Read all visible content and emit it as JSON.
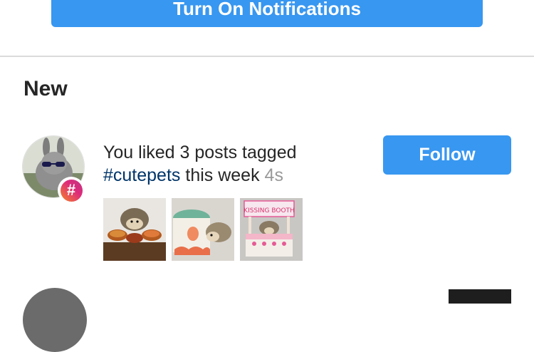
{
  "header": {
    "notifications_button_label": "Turn On Notifications"
  },
  "section": {
    "title": "New"
  },
  "activity": {
    "text_prefix": "You liked 3 posts tagged ",
    "hashtag": "#cutepets",
    "text_suffix": " this week",
    "time_ago": "4s",
    "follow_label": "Follow",
    "badge_icon": "hashtag-icon",
    "badge_glyph": "#",
    "thumbnails": [
      {
        "name": "hedgehog-with-pies",
        "sign_text": ""
      },
      {
        "name": "hedgehog-with-cake",
        "sign_text": ""
      },
      {
        "name": "hedgehog-kissing-booth",
        "sign_text": "KISSING BOOTH"
      }
    ]
  },
  "colors": {
    "accent": "#3897f0",
    "hashtag_link": "#003569",
    "muted": "#999999",
    "divider": "#dbdbdb"
  }
}
